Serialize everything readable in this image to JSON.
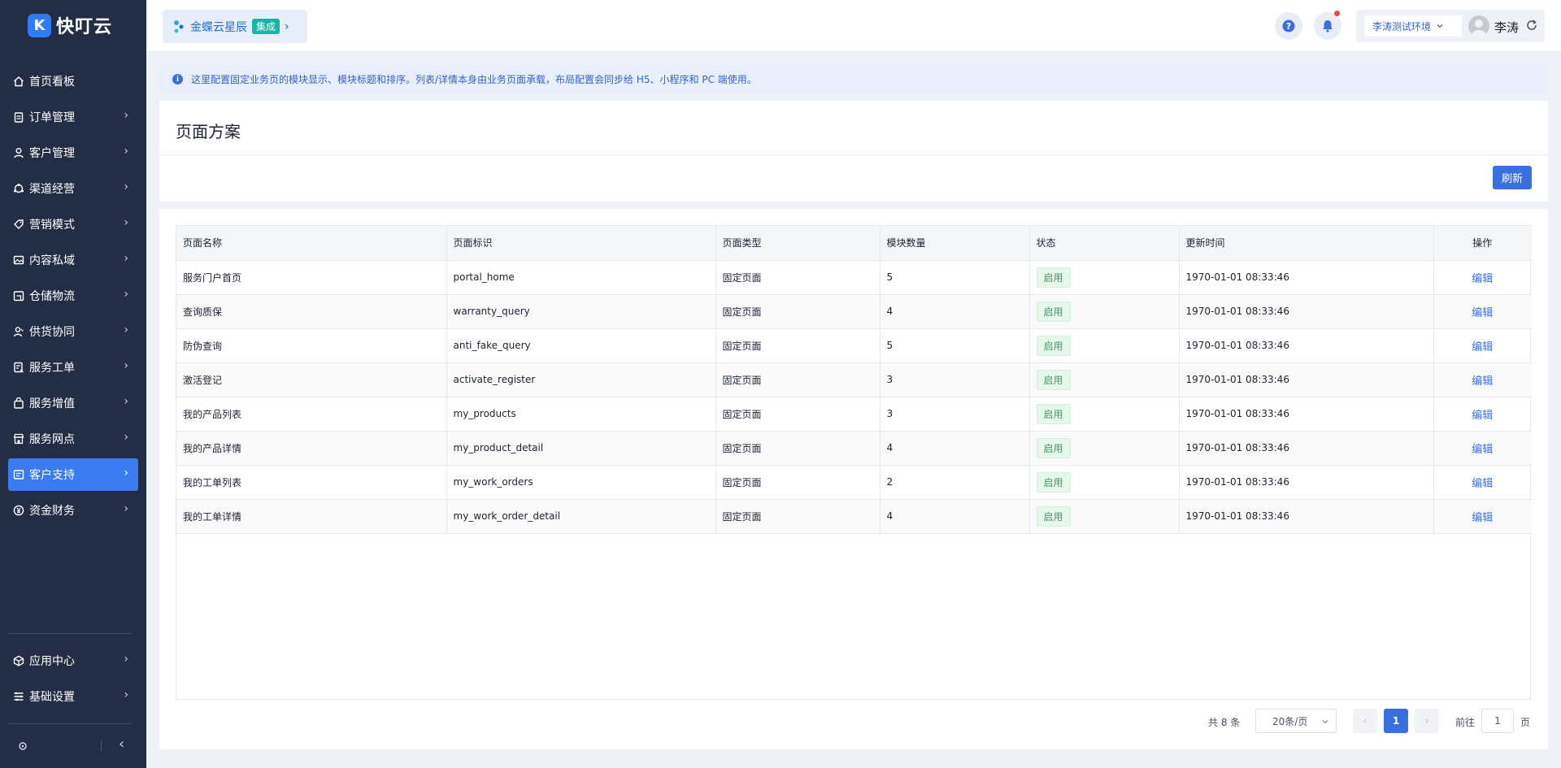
{
  "brand": {
    "name": "快叮云"
  },
  "sidebar": {
    "items": [
      {
        "label": "首页看板",
        "icon": "home-icon",
        "chevron": false
      },
      {
        "label": "订单管理",
        "icon": "clipboard-icon",
        "chevron": true
      },
      {
        "label": "客户管理",
        "icon": "user-icon",
        "chevron": true
      },
      {
        "label": "渠道经营",
        "icon": "channel-icon",
        "chevron": true
      },
      {
        "label": "营销模式",
        "icon": "tag-icon",
        "chevron": true
      },
      {
        "label": "内容私域",
        "icon": "image-icon",
        "chevron": true
      },
      {
        "label": "仓储物流",
        "icon": "warehouse-icon",
        "chevron": true
      },
      {
        "label": "供货协同",
        "icon": "supplier-icon",
        "chevron": true
      },
      {
        "label": "服务工单",
        "icon": "work-order-icon",
        "chevron": true
      },
      {
        "label": "服务增值",
        "icon": "bag-icon",
        "chevron": true
      },
      {
        "label": "服务网点",
        "icon": "store-icon",
        "chevron": true
      },
      {
        "label": "客户支持",
        "icon": "support-icon",
        "chevron": true,
        "active": true
      },
      {
        "label": "资金财务",
        "icon": "yuan-icon",
        "chevron": true
      }
    ],
    "bottom_items": [
      {
        "label": "应用中心",
        "icon": "cube-icon"
      },
      {
        "label": "基础设置",
        "icon": "settings-list-icon"
      }
    ],
    "chevron_glyph": "›",
    "collapse_glyph": "‹"
  },
  "header": {
    "integration": {
      "label": "金蝶云星辰",
      "badge": "集成",
      "chevron": "›"
    },
    "env": {
      "label": "李涛测试环境"
    },
    "user": {
      "name": "李涛"
    }
  },
  "notice": {
    "text": "这里配置固定业务页的模块显示、模块标题和排序。列表/详情本身由业务页面承载，布局配置会同步给 H5、小程序和 PC 端使用。"
  },
  "scheme": {
    "title": "页面方案",
    "refresh_label": "刷新"
  },
  "table": {
    "columns": [
      "页面名称",
      "页面标识",
      "页面类型",
      "模块数量",
      "状态",
      "更新时间",
      "操作"
    ],
    "rows": [
      {
        "name": "服务门户首页",
        "key": "portal_home",
        "type": "固定页面",
        "count": "5",
        "status": "启用",
        "updated": "1970-01-01 08:33:46",
        "action": "编辑"
      },
      {
        "name": "查询质保",
        "key": "warranty_query",
        "type": "固定页面",
        "count": "4",
        "status": "启用",
        "updated": "1970-01-01 08:33:46",
        "action": "编辑"
      },
      {
        "name": "防伪查询",
        "key": "anti_fake_query",
        "type": "固定页面",
        "count": "5",
        "status": "启用",
        "updated": "1970-01-01 08:33:46",
        "action": "编辑"
      },
      {
        "name": "激活登记",
        "key": "activate_register",
        "type": "固定页面",
        "count": "3",
        "status": "启用",
        "updated": "1970-01-01 08:33:46",
        "action": "编辑"
      },
      {
        "name": "我的产品列表",
        "key": "my_products",
        "type": "固定页面",
        "count": "3",
        "status": "启用",
        "updated": "1970-01-01 08:33:46",
        "action": "编辑"
      },
      {
        "name": "我的产品详情",
        "key": "my_product_detail",
        "type": "固定页面",
        "count": "4",
        "status": "启用",
        "updated": "1970-01-01 08:33:46",
        "action": "编辑"
      },
      {
        "name": "我的工单列表",
        "key": "my_work_orders",
        "type": "固定页面",
        "count": "2",
        "status": "启用",
        "updated": "1970-01-01 08:33:46",
        "action": "编辑"
      },
      {
        "name": "我的工单详情",
        "key": "my_work_order_detail",
        "type": "固定页面",
        "count": "4",
        "status": "启用",
        "updated": "1970-01-01 08:33:46",
        "action": "编辑"
      }
    ]
  },
  "pagination": {
    "total_text": "共 8 条",
    "page_size": "20条/页",
    "current_page": "1",
    "prev_glyph": "‹",
    "next_glyph": "›",
    "goto_label": "前往",
    "goto_value": "1",
    "goto_unit": "页"
  },
  "colors": {
    "sidebar_bg": "#232d45",
    "accent": "#3a6fe0",
    "status_green": "#3f9a5d"
  }
}
